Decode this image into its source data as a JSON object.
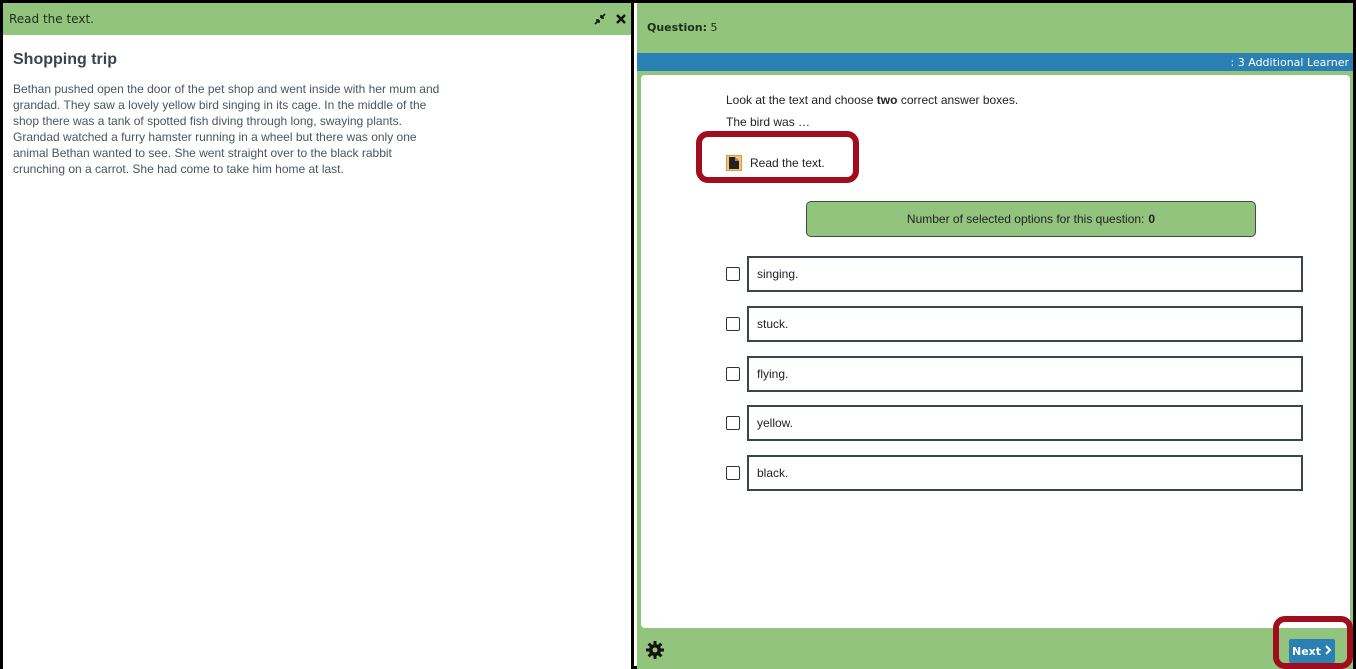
{
  "left_panel": {
    "header_title": "Read the text.",
    "passage_title": "Shopping trip",
    "passage_text": "Bethan pushed open the door of the pet shop and went inside with her mum and grandad. They saw a lovely yellow bird singing in its cage. In the middle of the shop there was a tank of spotted fish diving through long, swaying plants. Grandad watched a furry hamster running in a wheel but there was only one animal Bethan wanted to see. She went straight over to the black rabbit crunching on a carrot. She had come to take him home at last."
  },
  "question": {
    "label": "Question:",
    "number": "5",
    "bar_text": ": 3 Additional Learner",
    "instruction_pre": "Look at the text and choose",
    "instruction_bold": "two",
    "instruction_post": "correct answer boxes.",
    "stem": "The bird was …",
    "read_text_label": "Read the text.",
    "counter_label": "Number of selected options for this question:",
    "counter_value": "0",
    "options": [
      "singing.",
      "stuck.",
      "flying.",
      "yellow.",
      "black."
    ]
  },
  "footer": {
    "next_label": "Next"
  },
  "colors": {
    "green": "#93c47d",
    "blue": "#2a7fb3",
    "highlight_red": "#a00d1c"
  }
}
